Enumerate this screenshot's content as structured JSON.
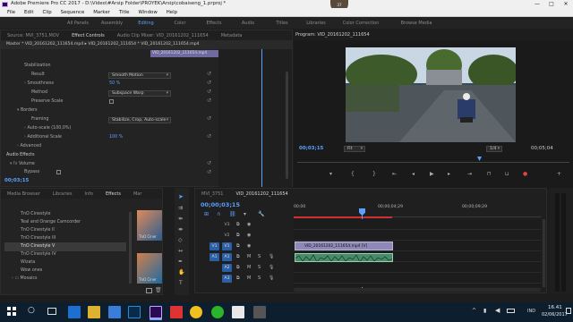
{
  "window": {
    "title": "Adobe Premiere Pro CC 2017 - D:\\Video\\#Arsip Folder\\PROYEK\\Arsip\\cobaiseng_1.prproj *",
    "minimize": "—",
    "maximize": "□",
    "close": "✕"
  },
  "badge": {
    "value": "37"
  },
  "menu": [
    "File",
    "Edit",
    "Clip",
    "Sequence",
    "Marker",
    "Title",
    "Window",
    "Help"
  ],
  "workspaces": [
    {
      "label": "All Panels",
      "active": false
    },
    {
      "label": "Assembly",
      "active": false
    },
    {
      "label": "Editing",
      "active": true
    },
    {
      "label": "Color",
      "active": false
    },
    {
      "label": "Effects",
      "active": false
    },
    {
      "label": "Audio",
      "active": false
    },
    {
      "label": "Titles",
      "active": false
    },
    {
      "label": "Libraries",
      "active": false
    },
    {
      "label": "Color Correction",
      "active": false
    },
    {
      "label": "Browse Media",
      "active": false
    }
  ],
  "source_tabs": [
    "Source: MVI_3751.MOV",
    "Effect Controls",
    "Audio Clip Mixer: VID_20161202_111654",
    "Metadata"
  ],
  "effect_controls": {
    "master": "Master * VID_20161202_111654.mp4 ▸ VID_20161202_111654 * VID_20161202_111654.mp4",
    "clip_label": "VID_20161202_111654.mp4",
    "stabilization": "Stabilization",
    "result_label": "Result",
    "result_value": "Smooth Motion",
    "smoothness_label": "Smoothness",
    "smoothness_value": "50 %",
    "method_label": "Method",
    "method_value": "Subspace Warp",
    "preserve_label": "Preserve Scale",
    "borders": "Borders",
    "framing_label": "Framing",
    "framing_value": "Stabilize, Crop, Auto-scale",
    "autoscale_label": "Auto-scale (100,0%)",
    "addscale_label": "Additional Scale",
    "addscale_value": "100 %",
    "advanced": "Advanced",
    "audio_effects": "Audio Effects",
    "volume": "Volume",
    "bypass": "Bypass",
    "timecode": "00;03;15"
  },
  "program": {
    "title": "Program: VID_20161202_111654",
    "timecode": "00;03;15",
    "fit": "Fit",
    "fraction": "1/4",
    "duration": "00;05;04"
  },
  "media_tabs": [
    "Media Browser",
    "Libraries",
    "Info",
    "Effects",
    "Mar"
  ],
  "effects_list": [
    "TnO Cinestyle",
    "Teal and Orange Camcorder",
    "TnO Cinestyle II",
    "TnO Cinestyle III",
    "TnO Cinestyle V",
    "TnO Cinestyle IV",
    "Wizata",
    "Wow ones",
    "Mosaics"
  ],
  "thumbnails": [
    {
      "label": "TnO Ciner"
    },
    {
      "label": "TnO Ciner"
    }
  ],
  "timeline": {
    "tabs": [
      "MVI_3751",
      "VID_20161202_111654"
    ],
    "timecode": "00;00;03;15",
    "ruler": [
      "00;00",
      "00;00;04;29",
      "00;00;09;29"
    ],
    "video_tracks": [
      "V3",
      "V2",
      "V1"
    ],
    "audio_tracks": [
      "A1",
      "A2",
      "A3"
    ],
    "v1_clip": "VID_20161202_111654.mp4 [V]"
  },
  "taskbar": {
    "time": "16.41",
    "date": "02/06/2017",
    "lang": "IND"
  }
}
